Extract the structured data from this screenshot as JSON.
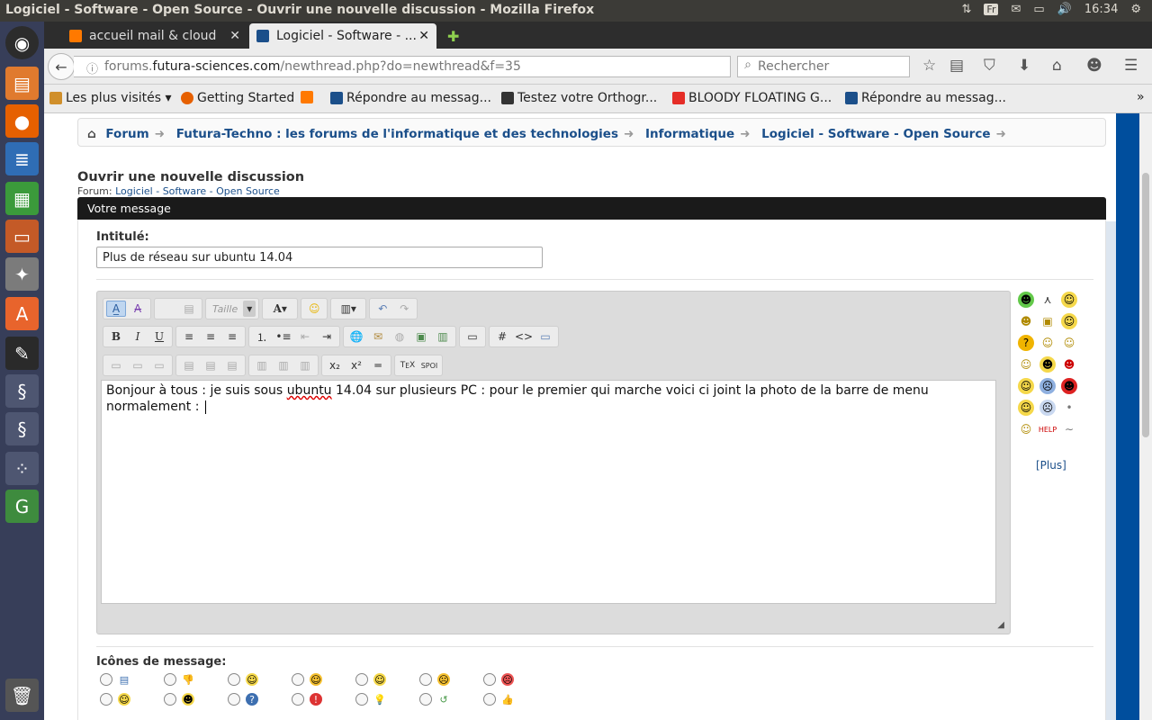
{
  "os": {
    "window_title": "Logiciel - Software - Open Source - Ouvrir une nouvelle discussion - Mozilla Firefox",
    "keyboard_layout": "Fr",
    "clock": "16:34"
  },
  "browser": {
    "tabs": [
      {
        "label": "accueil mail & cloud",
        "favicon_color": "#ff7900"
      },
      {
        "label": "Logiciel - Software - ...",
        "favicon_color": "#1b4f8a",
        "active": true
      }
    ],
    "new_tab_symbol": "✚",
    "url_prefix": "forums.",
    "url_domain": "futura-sciences.com",
    "url_path": "/newthread.php?do=newthread&f=35",
    "search_placeholder": "Rechercher",
    "bookmarks": [
      {
        "label": "Les plus visités ▾",
        "icon_color": "#d08f2b"
      },
      {
        "label": "Getting Started",
        "icon_color": "#e66000"
      },
      {
        "label": "",
        "icon_color": "#ff7900"
      },
      {
        "label": "Répondre au messag...",
        "icon_color": "#1b4f8a"
      },
      {
        "label": "Testez votre Orthogr...",
        "icon_color": "#333333"
      },
      {
        "label": "BLOODY FLOATING G...",
        "icon_color": "#e52d27"
      },
      {
        "label": "Répondre au messag...",
        "icon_color": "#1b4f8a"
      }
    ]
  },
  "forum": {
    "breadcrumb": [
      "Forum",
      "Futura-Techno : les forums de l'informatique et des technologies",
      "Informatique",
      "Logiciel - Software - Open Source"
    ],
    "page_title": "Ouvrir une nouvelle discussion",
    "forum_prefix": "Forum:",
    "forum_name": "Logiciel - Software - Open Source",
    "section_title": "Votre message",
    "title_label": "Intitulé:",
    "title_value": "Plus de réseau sur ubuntu 14.04",
    "font_size_placeholder": "Taille",
    "message_before": "Bonjour à tous : je suis sous ",
    "message_misspelled": "ubuntu",
    "message_after": " 14.04 sur plusieurs PC : pour le premier qui marche  voici ci joint la photo de la barre de menu normalement : ",
    "smilies_more": "[Plus]",
    "message_icons_label": "Icônes de message:"
  },
  "colors": {
    "link": "#1b4f8a",
    "header_bar": "#1a1a1a",
    "side_blue": "#004e9d",
    "launcher": "#373e59"
  }
}
